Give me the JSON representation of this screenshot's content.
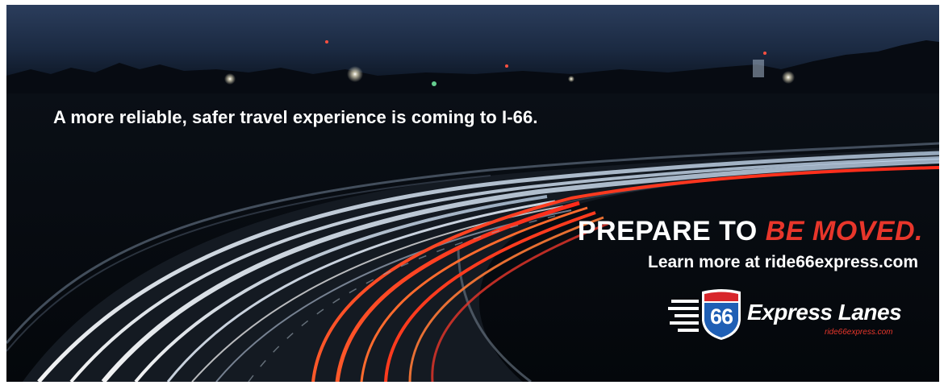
{
  "tagline": "A more reliable, safer travel experience is coming to I-66.",
  "headline": {
    "prefix": "PREPARE TO ",
    "accent": "BE MOVED."
  },
  "cta": "Learn more at ride66express.com",
  "logo": {
    "shield_number": "66",
    "brand": "Express Lanes",
    "url": "ride66express.com"
  },
  "colors": {
    "accent_red": "#e8362b",
    "shield_blue": "#1f5fb5",
    "night_sky": "#1a2b45"
  }
}
